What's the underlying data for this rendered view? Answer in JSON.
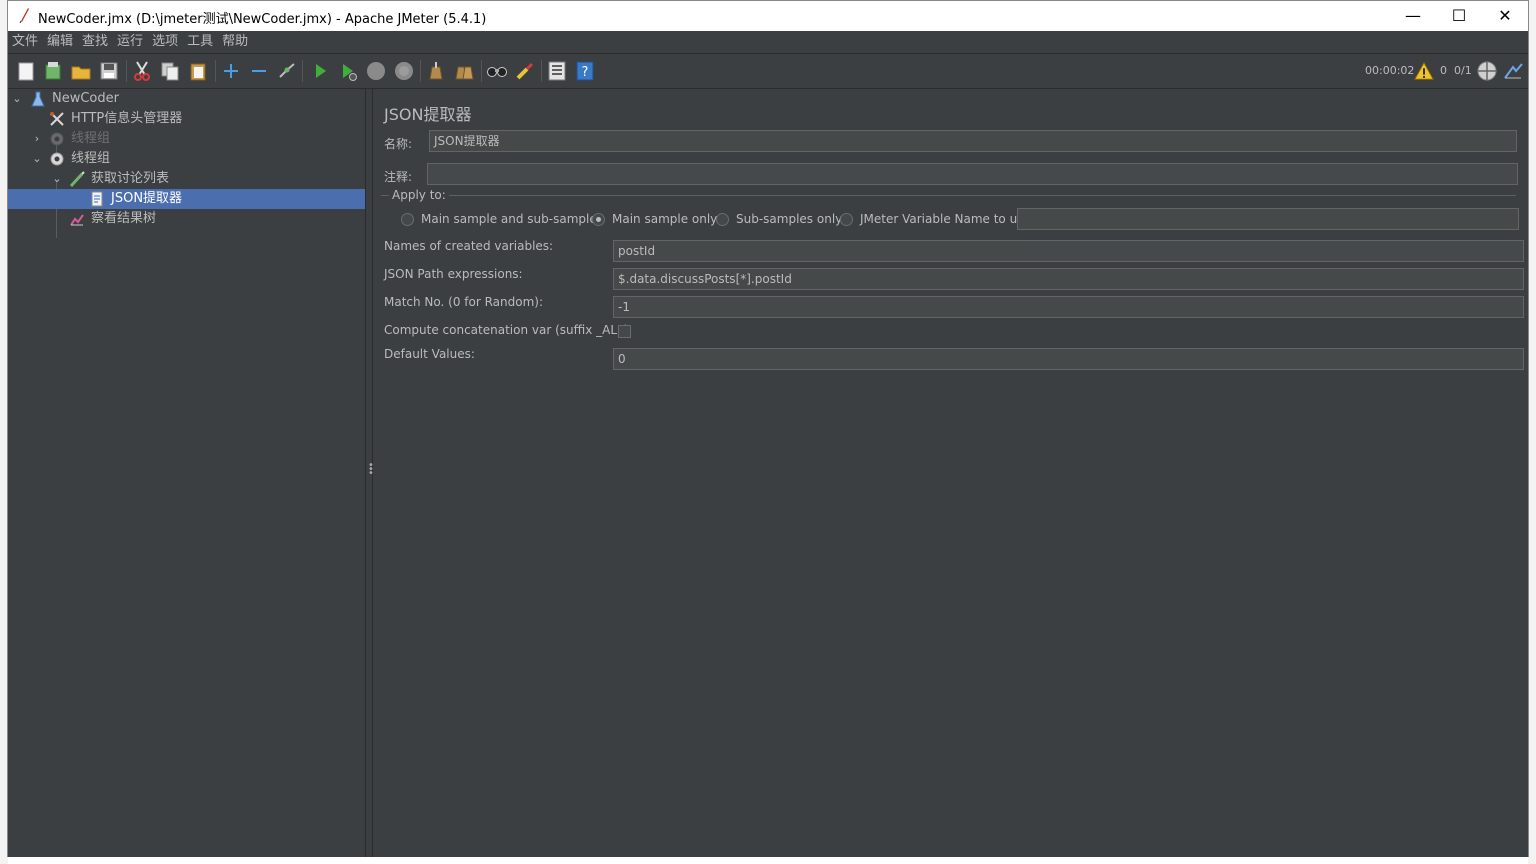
{
  "window": {
    "title": "NewCoder.jmx (D:\\jmeter测试\\NewCoder.jmx) - Apache JMeter (5.4.1)",
    "minimize": "—",
    "maximize": "☐",
    "close": "✕"
  },
  "menu": [
    "文件",
    "编辑",
    "查找",
    "运行",
    "选项",
    "工具",
    "帮助"
  ],
  "toolbar": {
    "icons": [
      "new-icon",
      "templates-icon",
      "open-icon",
      "save-icon",
      "cut-icon",
      "copy-icon",
      "paste-icon",
      "expand-icon",
      "collapse-icon",
      "toggle-icon",
      "start-icon",
      "start-no-pause-icon",
      "stop-icon",
      "shutdown-icon",
      "clear-icon",
      "clear-all-icon",
      "search-icon",
      "reset-search-icon",
      "function-helper-icon",
      "help-icon"
    ],
    "timer": "00:00:02",
    "warnings": "0",
    "threads": "0/1"
  },
  "tree": [
    {
      "label": "NewCoder",
      "icon": "test-plan-icon",
      "level": 0,
      "expanded": true
    },
    {
      "label": "HTTP信息头管理器",
      "icon": "config-tool-icon",
      "level": 1
    },
    {
      "label": "线程组",
      "icon": "thread-group-icon",
      "level": 1,
      "expanded": false,
      "disabled": true
    },
    {
      "label": "线程组",
      "icon": "thread-group-icon",
      "level": 1,
      "expanded": true
    },
    {
      "label": "获取讨论列表",
      "icon": "sampler-icon",
      "level": 2,
      "expanded": true
    },
    {
      "label": "JSON提取器",
      "icon": "extractor-icon",
      "level": 3,
      "selected": true
    },
    {
      "label": "察看结果树",
      "icon": "listener-icon",
      "level": 2
    }
  ],
  "editor": {
    "title": "JSON提取器",
    "name_label": "名称:",
    "name_value": "JSON提取器",
    "comment_label": "注释:",
    "comment_value": "",
    "apply_to_label": "Apply to:",
    "apply_options": [
      "Main sample and sub-samples",
      "Main sample only",
      "Sub-samples only",
      "JMeter Variable Name to use"
    ],
    "apply_selected": "Main sample only",
    "variable_name_value": "",
    "fields": [
      {
        "label": "Names of created variables:",
        "value": "postId"
      },
      {
        "label": "JSON Path expressions:",
        "value": "$.data.discussPosts[*].postId"
      },
      {
        "label": "Match No. (0 for Random):",
        "value": "-1"
      },
      {
        "label": "Compute concatenation var (suffix _ALL):",
        "checked": false
      },
      {
        "label": "Default Values:",
        "value": "0"
      }
    ]
  }
}
